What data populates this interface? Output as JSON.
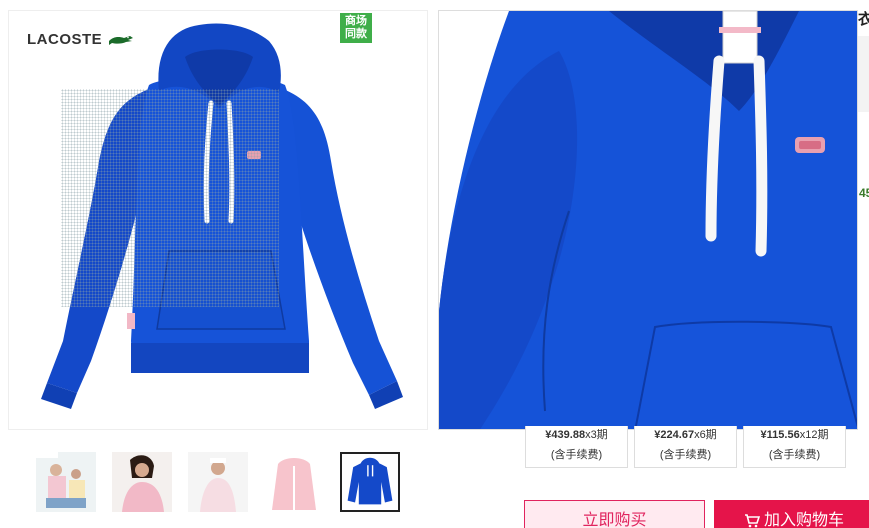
{
  "brand": {
    "name": "LACOSTE",
    "logo_icon": "crocodile-icon"
  },
  "badge": {
    "line1": "商场",
    "line2": "同款"
  },
  "title_fragment": "衣",
  "green_fragment": "45",
  "installments": [
    {
      "amount": "¥439.88",
      "period": "x3期",
      "fee": "(含手续费)"
    },
    {
      "amount": "¥224.67",
      "period": "x6期",
      "fee": "(含手续费)"
    },
    {
      "amount": "¥115.56",
      "period": "x12期",
      "fee": "(含手续费)"
    }
  ],
  "buttons": {
    "buy_now": "立即购买",
    "add_to_cart": "加入购物车",
    "cart_icon": "cart-icon"
  },
  "colors": {
    "hoodie": "#1449c9",
    "badge": "#3fae49",
    "cart_button": "#e5144a",
    "buy_button_text": "#e0245e"
  }
}
